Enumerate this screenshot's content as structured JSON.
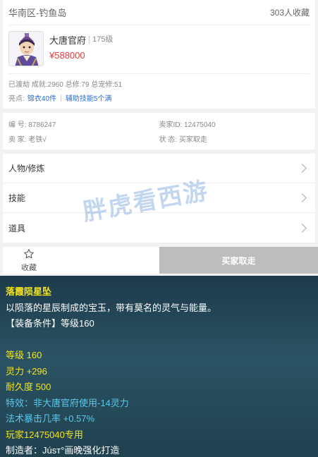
{
  "header": {
    "server": "华南区-钓鱼岛",
    "fav_count": "303人收藏"
  },
  "role": {
    "name": "大唐官府",
    "level": "175级",
    "price": "¥588000"
  },
  "stats": {
    "line1": "已渡劫 成就:2960 总修:79 总宠修:51",
    "highlight_label": "亮点:",
    "highlights": [
      "锦衣40件",
      "辅助技能5个满"
    ]
  },
  "meta": {
    "id": "编 号: 8786247",
    "seller_id": "卖家ID: 12475040",
    "seller": "卖 家: 老铁√",
    "status": "状 态: 买家取走"
  },
  "nav": [
    "人物/修炼",
    "技能",
    "道具"
  ],
  "watermark": "胖虎看西游",
  "actions": {
    "fav_label": "收藏",
    "buy_label": "买家取走"
  },
  "tooltip": {
    "name": "落霞陨星坠",
    "desc": "以陨落的星辰制成的宝玉，带有莫名的灵气与能量。",
    "req": "【装备条件】等级160",
    "level": "等级 160",
    "spirit": "灵力 +296",
    "durability": "耐久度 500",
    "effect": "特效：非大唐官府使用-14灵力",
    "crit": "法术暴击几率 +0.57%",
    "owner": "玩家12475040专用",
    "maker": "制造者：Júsт°画晚强化打造"
  },
  "colors": {
    "price": "#e8383d",
    "highlight": "#2a6fd6",
    "tooltip_yellow": "#f5e41b",
    "tooltip_blue": "#5ac8f0",
    "buy_bg": "#bdbdbd"
  }
}
